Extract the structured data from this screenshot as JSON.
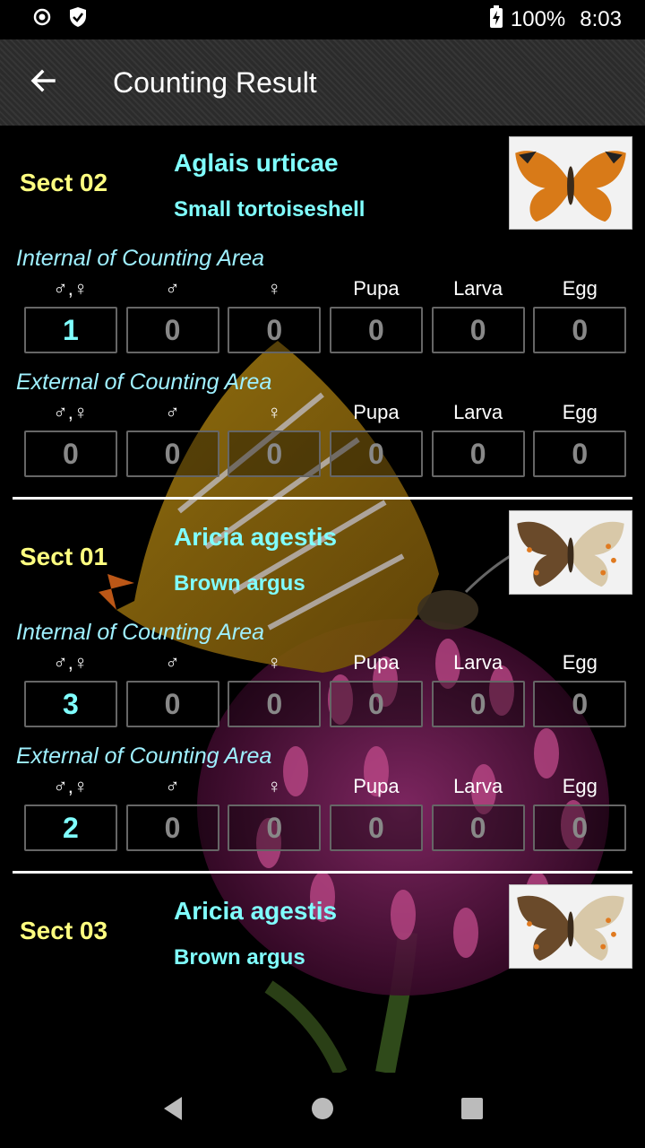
{
  "status": {
    "battery": "100%",
    "time": "8:03"
  },
  "app_bar": {
    "title": "Counting Result"
  },
  "columns": [
    "♂,♀",
    "♂",
    "♀",
    "Pupa",
    "Larva",
    "Egg"
  ],
  "sections": [
    {
      "sect": "Sect 02",
      "scientific_name": "Aglais urticae",
      "common_name": "Small tortoiseshell",
      "internal_label": "Internal of Counting Area",
      "internal": [
        "1",
        "0",
        "0",
        "0",
        "0",
        "0"
      ],
      "external_label": "External of Counting Area",
      "external": [
        "0",
        "0",
        "0",
        "0",
        "0",
        "0"
      ]
    },
    {
      "sect": "Sect 01",
      "scientific_name": "Aricia agestis",
      "common_name": "Brown argus",
      "internal_label": "Internal of Counting Area",
      "internal": [
        "3",
        "0",
        "0",
        "0",
        "0",
        "0"
      ],
      "external_label": "External of Counting Area",
      "external": [
        "2",
        "0",
        "0",
        "0",
        "0",
        "0"
      ]
    },
    {
      "sect": "Sect 03",
      "scientific_name": "Aricia agestis",
      "common_name": "Brown argus"
    }
  ]
}
